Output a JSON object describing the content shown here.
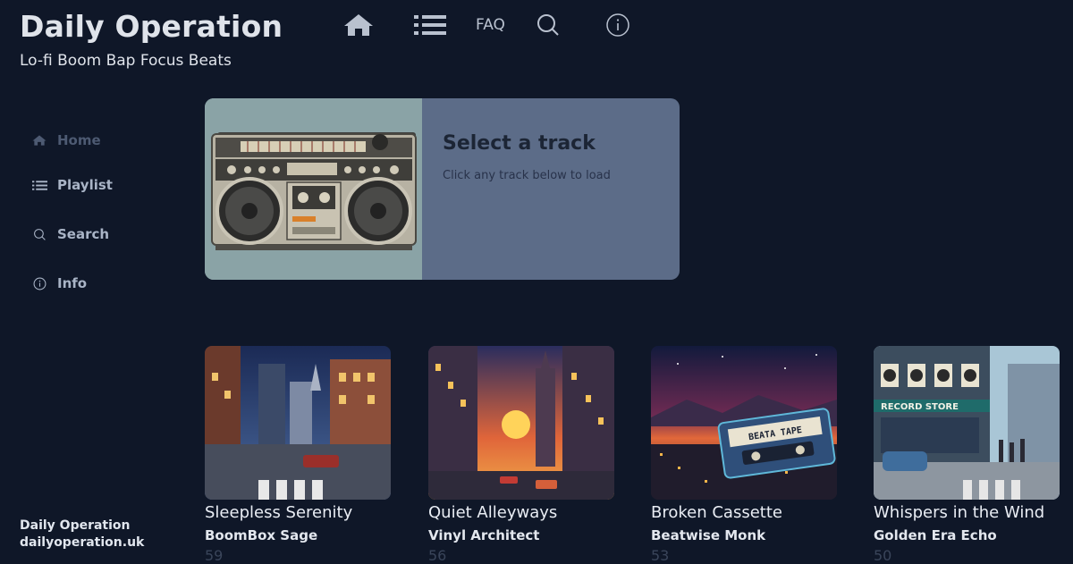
{
  "header": {
    "title": "Daily Operation",
    "subtitle": "Lo-fi Boom Bap Focus Beats"
  },
  "topnav": {
    "home_icon": "home-icon",
    "list_icon": "list-icon",
    "faq_label": "FAQ",
    "search_icon": "search-icon",
    "info_icon": "info-icon"
  },
  "sidebar": {
    "items": [
      {
        "label": "Home",
        "icon": "home-icon"
      },
      {
        "label": "Playlist",
        "icon": "list-icon"
      },
      {
        "label": "Search",
        "icon": "search-icon"
      },
      {
        "label": "Info",
        "icon": "info-icon"
      }
    ]
  },
  "player": {
    "title": "Select a track",
    "hint": "Click any track below to load",
    "art": "boombox-image"
  },
  "tracks": [
    {
      "title": "Sleepless Serenity",
      "artist": "BoomBox Sage",
      "count": "59"
    },
    {
      "title": "Quiet Alleyways",
      "artist": "Vinyl Architect",
      "count": "56"
    },
    {
      "title": "Broken Cassette",
      "artist": "Beatwise Monk",
      "count": "53"
    },
    {
      "title": "Whispers in the Wind",
      "artist": "Golden Era Echo",
      "count": "50"
    }
  ],
  "cover_texts": {
    "cassette_label": "BEATA TAPE",
    "store_sign": "RECORD STORE"
  },
  "footer": {
    "name": "Daily Operation",
    "url": "dailyoperation.uk"
  },
  "colors": {
    "background": "#0f1728",
    "player_panel": "#5c6c88",
    "text": "#e7ebf3"
  }
}
